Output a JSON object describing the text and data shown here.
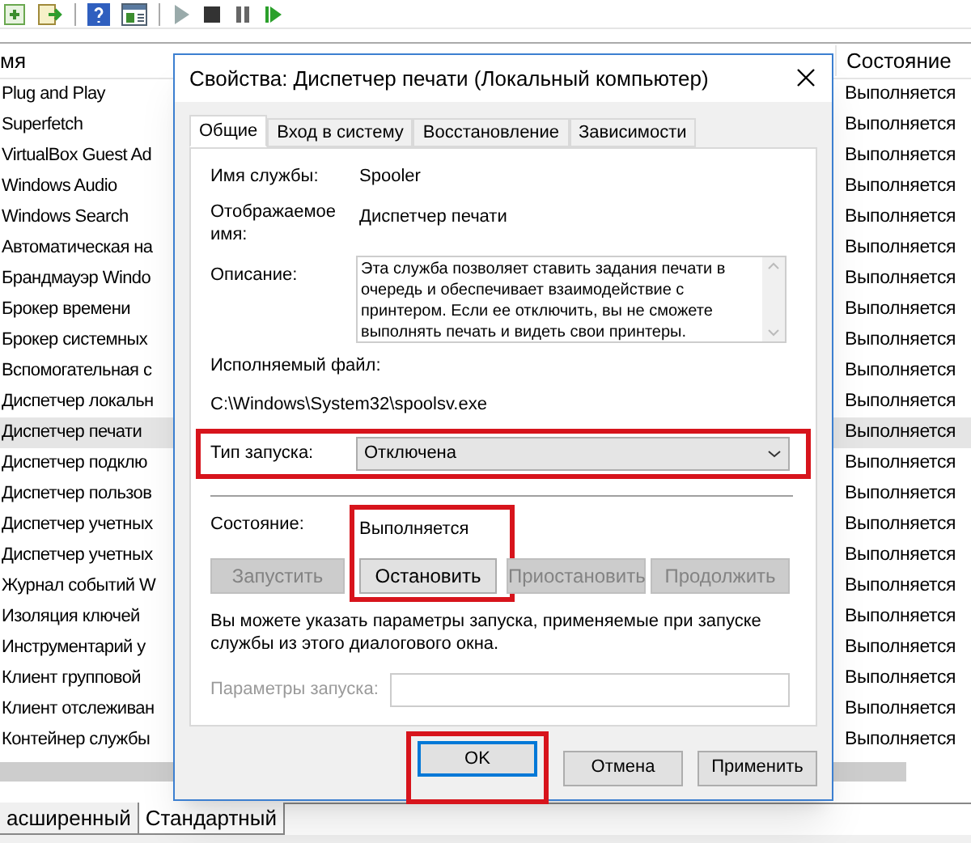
{
  "services": {
    "columns": [
      "мя",
      "Состояние"
    ],
    "rows": [
      {
        "name": "Plug and Play",
        "status": "Выполняется",
        "selected": false
      },
      {
        "name": "Superfetch",
        "status": "Выполняется",
        "selected": false
      },
      {
        "name": "VirtualBox Guest Ad",
        "status": "Выполняется",
        "selected": false
      },
      {
        "name": "Windows Audio",
        "status": "Выполняется",
        "selected": false
      },
      {
        "name": "Windows Search",
        "status": "Выполняется",
        "selected": false
      },
      {
        "name": "Автоматическая на",
        "status": "Выполняется",
        "selected": false
      },
      {
        "name": "Брандмауэр Windo",
        "status": "Выполняется",
        "selected": false
      },
      {
        "name": "Брокер времени",
        "status": "Выполняется",
        "selected": false
      },
      {
        "name": "Брокер системных",
        "status": "Выполняется",
        "selected": false
      },
      {
        "name": "Вспомогательная с",
        "status": "Выполняется",
        "selected": false
      },
      {
        "name": "Диспетчер локальн",
        "status": "Выполняется",
        "selected": false
      },
      {
        "name": "Диспетчер печати",
        "status": "Выполняется",
        "selected": true
      },
      {
        "name": "Диспетчер подклю",
        "status": "Выполняется",
        "selected": false
      },
      {
        "name": "Диспетчер пользов",
        "status": "Выполняется",
        "selected": false
      },
      {
        "name": "Диспетчер учетных",
        "status": "Выполняется",
        "selected": false
      },
      {
        "name": "Диспетчер учетных",
        "status": "Выполняется",
        "selected": false
      },
      {
        "name": "Журнал событий W",
        "status": "Выполняется",
        "selected": false
      },
      {
        "name": "Изоляция ключей",
        "status": "Выполняется",
        "selected": false
      },
      {
        "name": "Инструментарий у",
        "status": "Выполняется",
        "selected": false
      },
      {
        "name": "Клиент групповой",
        "status": "Выполняется",
        "selected": false
      },
      {
        "name": "Клиент отслеживан",
        "status": "Выполняется",
        "selected": false
      },
      {
        "name": "Контейнер службы",
        "status": "Выполняется",
        "selected": false
      }
    ]
  },
  "view_tabs": [
    {
      "label": "асширенный",
      "selected": false
    },
    {
      "label": "Стандартный",
      "selected": true
    }
  ],
  "dialog": {
    "title": "Свойства: Диспетчер печати (Локальный компьютер)",
    "tabs": [
      {
        "label": "Общие",
        "selected": true
      },
      {
        "label": "Вход в систему",
        "selected": false
      },
      {
        "label": "Восстановление",
        "selected": false
      },
      {
        "label": "Зависимости",
        "selected": false
      }
    ],
    "service_name": {
      "label": "Имя службы:",
      "value": "Spooler"
    },
    "display_name": {
      "label": "Отображаемое имя:",
      "value": "Диспетчер печати"
    },
    "description": {
      "label": "Описание:",
      "value": "Эта служба позволяет ставить задания печати в очередь и обеспечивает взаимодействие с принтером. Если ее отключить, вы не сможете выполнять печать и видеть свои принтеры."
    },
    "executable": {
      "label": "Исполняемый файл:",
      "value": "C:\\Windows\\System32\\spoolsv.exe"
    },
    "startup_type": {
      "label": "Тип запуска:",
      "value": "Отключена"
    },
    "status": {
      "label": "Состояние:",
      "value": "Выполняется"
    },
    "service_buttons": [
      {
        "label": "Запустить",
        "disabled": true
      },
      {
        "label": "Остановить",
        "disabled": false
      },
      {
        "label": "Приостановить",
        "disabled": true
      },
      {
        "label": "Продолжить",
        "disabled": true
      }
    ],
    "hint": "Вы можете указать параметры запуска, применяемые при запуске службы из этого диалогового окна.",
    "start_parameters": {
      "label": "Параметры запуска:",
      "disabled": true
    },
    "buttons": [
      {
        "label": "OK",
        "focused": true
      },
      {
        "label": "Отмена",
        "focused": false
      },
      {
        "label": "Применить",
        "focused": false
      }
    ]
  }
}
